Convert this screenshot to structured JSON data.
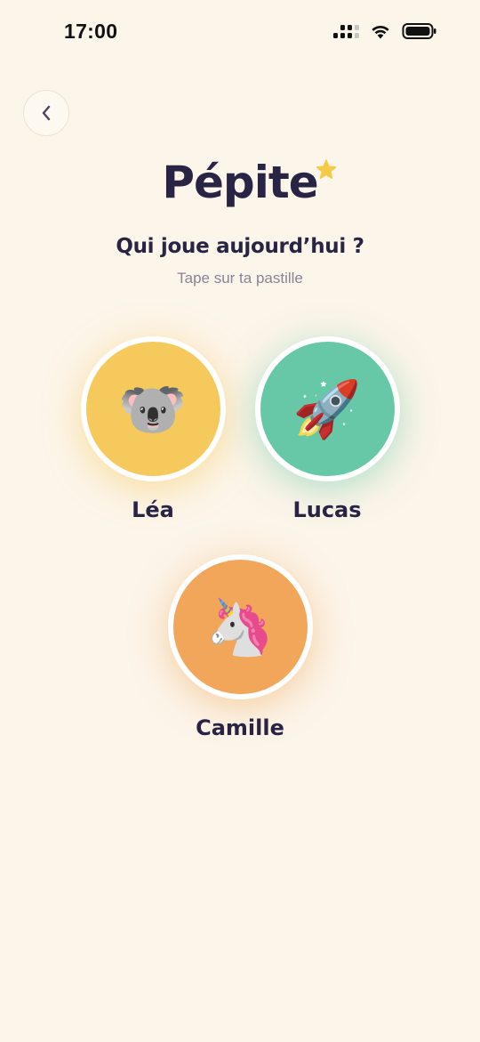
{
  "status_bar": {
    "time": "17:00",
    "icons": [
      "signal-icon",
      "wifi-icon",
      "battery-icon"
    ]
  },
  "header": {
    "back_icon": "chevron-left-icon"
  },
  "brand": {
    "name": "Pépite",
    "star_icon": "star-icon",
    "star_color": "#f6c947"
  },
  "prompt": {
    "question": "Qui joue aujourd’hui ?",
    "subtitle": "Tape sur ta pastille"
  },
  "profiles": [
    {
      "name": "Léa",
      "avatar": "🐨",
      "avatar_icon": "koala-icon",
      "color": "#f6c95c"
    },
    {
      "name": "Lucas",
      "avatar": "🚀",
      "avatar_icon": "rocket-icon",
      "color": "#66c8a7"
    },
    {
      "name": "Camille",
      "avatar": "🦄",
      "avatar_icon": "unicorn-icon",
      "color": "#f2a65a"
    }
  ],
  "colors": {
    "background": "#fcf5e9",
    "text": "#2a2444",
    "muted_text": "#8a8398"
  }
}
